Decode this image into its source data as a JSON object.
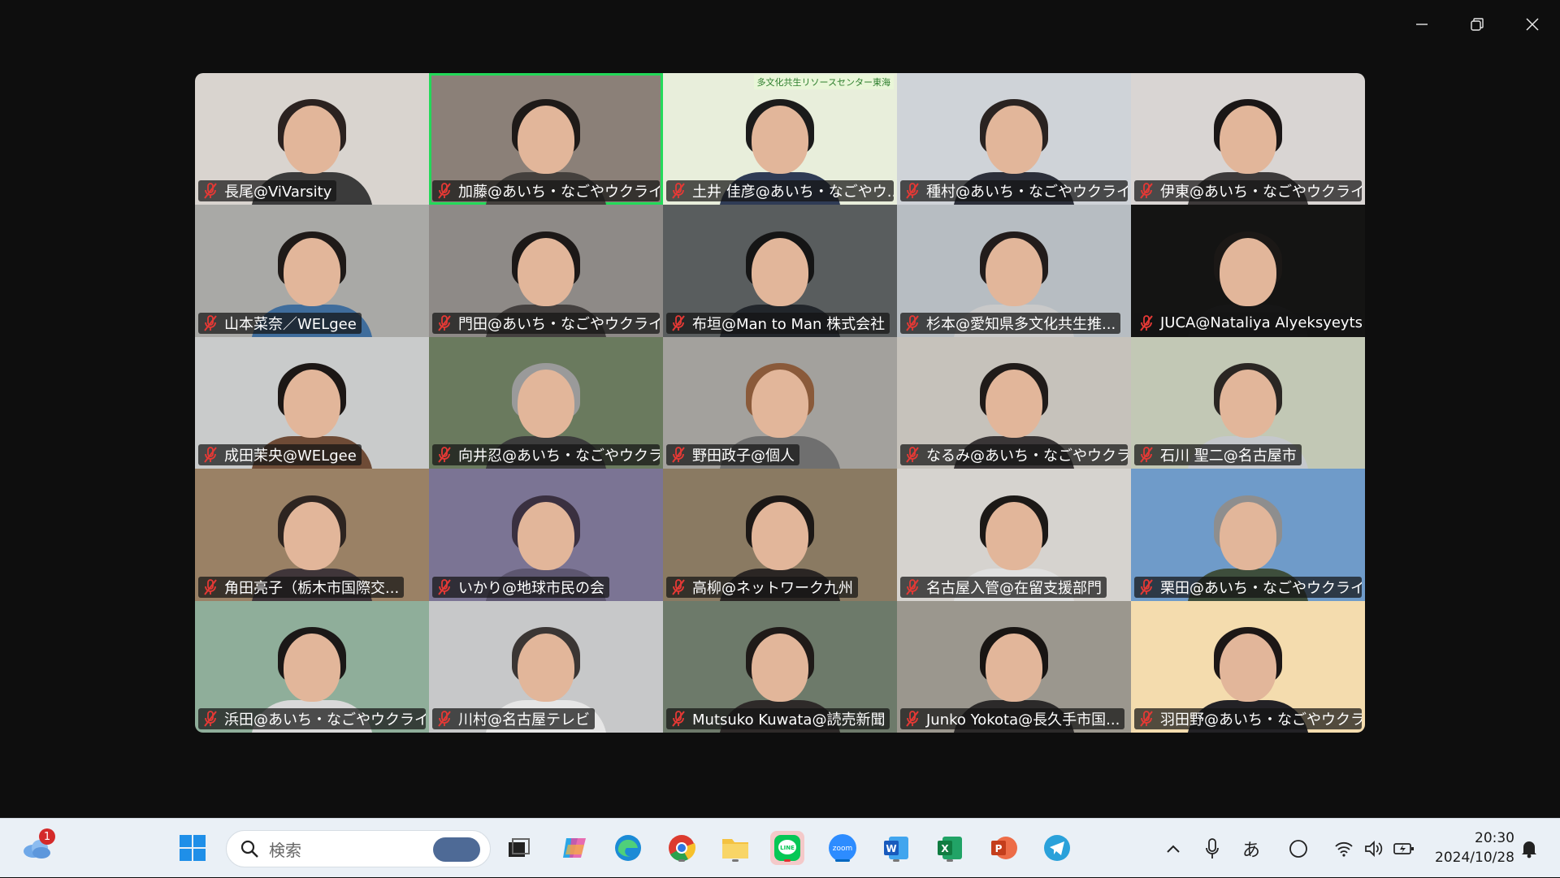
{
  "window": {
    "controls": [
      "minimize-icon",
      "restore-icon",
      "close-icon"
    ]
  },
  "gallery": {
    "active_index": 1,
    "tiles": [
      {
        "name": "長尾@ViVarsity",
        "bg": "#d9d4cf",
        "hair": "#2b2220",
        "body": "#3b3b3b"
      },
      {
        "name": "加藤@あいち・なごやウクライナ避...",
        "bg": "#8b8078",
        "hair": "#1e1a18",
        "body": "#44403d"
      },
      {
        "name": "土井 佳彦@あいち・なごやウ...",
        "bg": "#e8eedb",
        "hair": "#1b1b1b",
        "body": "#2f3b55",
        "banner": "多文化共生リソースセンター東海"
      },
      {
        "name": "種村@あいち・なごやウクライナ...",
        "bg": "#cfd3d8",
        "hair": "#2a2321",
        "body": "#2c2f3a"
      },
      {
        "name": "伊東@あいち・なごやウクライナ避...",
        "bg": "#d9d5d3",
        "hair": "#1a1616",
        "body": "#3d3a3a"
      },
      {
        "name": "山本菜奈／WELgee",
        "bg": "#a9a9a6",
        "hair": "#1f1a18",
        "body": "#3f6d9c"
      },
      {
        "name": "門田@あいち・なごやウクライナ...",
        "bg": "#8e8a87",
        "hair": "#1c1817",
        "body": "#44403f"
      },
      {
        "name": "布垣@Man to Man 株式会社",
        "bg": "#595d5e",
        "hair": "#151515",
        "body": "#22262b"
      },
      {
        "name": "杉本@愛知県多文化共生推...",
        "bg": "#b7bdc2",
        "hair": "#221c1b",
        "body": "#c9c9c9"
      },
      {
        "name": "JUCA@Nataliya Alyeksyeyts...",
        "bg": "#141413",
        "hair": "#1b1816",
        "body": "#161616"
      },
      {
        "name": "成田茉央@WELgee",
        "bg": "#c9cbcb",
        "hair": "#1c1715",
        "body": "#6e4b36"
      },
      {
        "name": "向井忍@あいち・なごやウクラ...",
        "bg": "#6a7a5e",
        "hair": "#9a9a9a",
        "body": "#3c3c3c"
      },
      {
        "name": "野田政子@個人",
        "bg": "#a3a19d",
        "hair": "#8a5a3a",
        "body": "#6f6f6f"
      },
      {
        "name": "なるみ@あいち・なごやウクライ...",
        "bg": "#c6c2bb",
        "hair": "#201b19",
        "body": "#3a3637"
      },
      {
        "name": "石川 聖二@名古屋市",
        "bg": "#c2c8b5",
        "hair": "#2a2623",
        "body": "#c5c8cc"
      },
      {
        "name": "角田亮子（栃木市国際交...",
        "bg": "#9a8165",
        "hair": "#2d2420",
        "body": "#40363a"
      },
      {
        "name": "いかり@地球市民の会",
        "bg": "#7b7494",
        "hair": "#3a3040",
        "body": "#5d5670"
      },
      {
        "name": "高柳@ネットワーク九州",
        "bg": "#8a7a62",
        "hair": "#1c1816",
        "body": "#2b2624"
      },
      {
        "name": "名古屋入管@在留支援部門",
        "bg": "#d6d3cf",
        "hair": "#1c1917",
        "body": "#e0e0e0"
      },
      {
        "name": "栗田@あいち・なごやウクライナ...",
        "bg": "#6f9bc9",
        "hair": "#8e8e8e",
        "body": "#3e4e3c"
      },
      {
        "name": "浜田@あいち・なごやウクライナ...",
        "bg": "#8fae9a",
        "hair": "#1b1817",
        "body": "#d9d9d9"
      },
      {
        "name": "川村@名古屋テレビ",
        "bg": "#c7c8c9",
        "hair": "#3b3634",
        "body": "#e6e6e6"
      },
      {
        "name": "Mutsuko Kuwata@読売新聞",
        "bg": "#6d7a6a",
        "hair": "#1f1a18",
        "body": "#2e2a29"
      },
      {
        "name": "Junko Yokota@長久手市国...",
        "bg": "#9b978e",
        "hair": "#181513",
        "body": "#2c2a2a"
      },
      {
        "name": "羽田野@あいち・なごやウクラ...",
        "bg": "#f4dcae",
        "hair": "#1c1716",
        "body": "#232226"
      }
    ]
  },
  "taskbar": {
    "weather_badge": "1",
    "search_placeholder": "検索",
    "ime_label": "あ",
    "clock_time": "20:30",
    "clock_date": "2024/10/28",
    "apps": [
      "windows-start-icon",
      "task-view-icon",
      "copilot-icon",
      "edge-icon",
      "chrome-icon",
      "file-explorer-icon",
      "line-icon",
      "zoom-icon",
      "word-icon",
      "excel-icon",
      "powerpoint-icon",
      "telegram-icon"
    ]
  }
}
